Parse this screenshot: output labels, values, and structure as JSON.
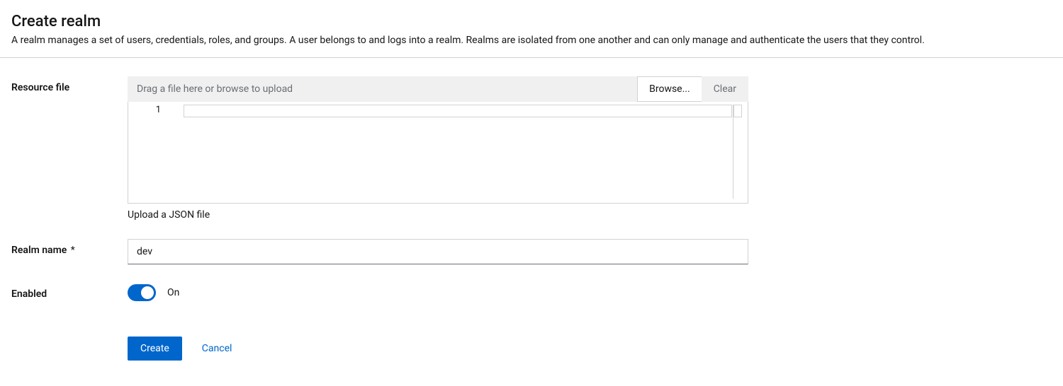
{
  "header": {
    "title": "Create realm",
    "description": "A realm manages a set of users, credentials, roles, and groups. A user belongs to and logs into a realm. Realms are isolated from one another and can only manage and authenticate the users that they control."
  },
  "form": {
    "resource_file": {
      "label": "Resource file",
      "placeholder": "Drag a file here or browse to upload",
      "browse_label": "Browse...",
      "clear_label": "Clear",
      "line_number": "1",
      "helper": "Upload a JSON file"
    },
    "realm_name": {
      "label": "Realm name",
      "required_marker": "*",
      "value": "dev"
    },
    "enabled": {
      "label": "Enabled",
      "state_label": "On",
      "state": true
    },
    "actions": {
      "create_label": "Create",
      "cancel_label": "Cancel"
    }
  }
}
